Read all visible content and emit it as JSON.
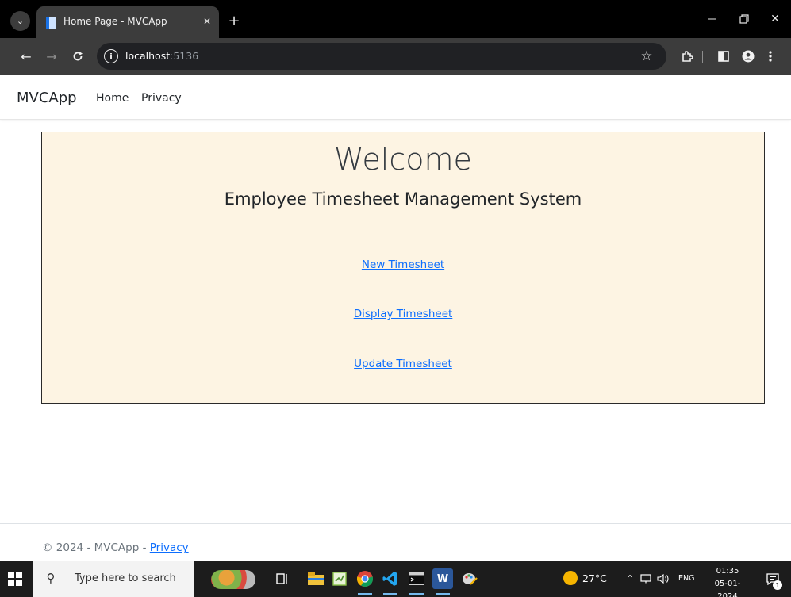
{
  "browser": {
    "tab": {
      "title": "Home Page - MVCApp",
      "close_icon": "close-icon",
      "favicon": "page-favicon-icon"
    },
    "tab_search_icon": "chevron-down-icon",
    "new_tab_icon": "plus-icon",
    "window_controls": {
      "minimize": "minimize-icon",
      "restore": "restore-icon",
      "close": "close-icon"
    },
    "toolbar": {
      "back_icon": "arrow-left-icon",
      "forward_icon": "arrow-right-icon",
      "reload_icon": "reload-icon",
      "site_info_icon": "info-icon",
      "url_host": "localhost",
      "url_port": ":5136",
      "bookmark_icon": "star-icon",
      "extensions_icon": "puzzle-icon",
      "side_panel_icon": "side-panel-icon",
      "profile_icon": "profile-icon",
      "menu_icon": "more-vertical-icon"
    }
  },
  "navbar": {
    "brand": "MVCApp",
    "links": [
      "Home",
      "Privacy"
    ]
  },
  "main": {
    "heading": "Welcome",
    "subtitle": "Employee Timesheet Management System",
    "actions": [
      "New Timesheet",
      "Display Timesheet",
      "Update Timesheet"
    ],
    "panel_color": "#fdf4e3",
    "link_color": "#0d6efd"
  },
  "footer": {
    "copyright": "© 2024 - MVCApp - ",
    "privacy_link": "Privacy"
  },
  "taskbar": {
    "search_placeholder": "Type here to search",
    "apps": [
      "task-view-icon",
      "file-explorer-icon",
      "notepad-plus-icon",
      "chrome-icon",
      "vscode-icon",
      "terminal-icon",
      "word-icon",
      "paint-icon"
    ],
    "word_glyph": "W",
    "temperature": "27°C",
    "language": "ENG",
    "time": "01:35",
    "date": "05-01-2024",
    "notification_count": "1"
  }
}
